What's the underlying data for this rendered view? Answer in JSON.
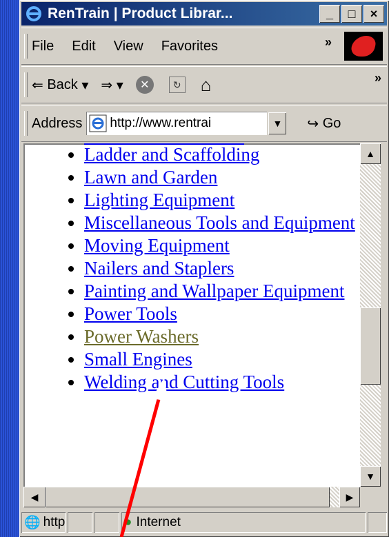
{
  "window": {
    "title": "RenTrain | Product Librar..."
  },
  "title_controls": [
    "_",
    "□",
    "×"
  ],
  "menu": {
    "items": [
      "File",
      "Edit",
      "View",
      "Favorites"
    ],
    "overflow": "»"
  },
  "navbar": {
    "back_label": "Back",
    "back_arrow": "⇐",
    "forward_arrow": "⇒",
    "overflow": "»"
  },
  "address": {
    "label": "Address",
    "value": "http://www.rentrai",
    "go_label": "Go"
  },
  "list": {
    "items": [
      {
        "label": "Ladder and Scaffolding",
        "visited": false
      },
      {
        "label": "Lawn and Garden",
        "visited": false
      },
      {
        "label": "Lighting Equipment",
        "visited": false
      },
      {
        "label": "Miscellaneous Tools and Equipment",
        "visited": false
      },
      {
        "label": "Moving Equipment",
        "visited": false
      },
      {
        "label": "Nailers and Staplers",
        "visited": false
      },
      {
        "label": "Painting and Wallpaper Equipment",
        "visited": false
      },
      {
        "label": "Power Tools",
        "visited": false
      },
      {
        "label": "Power Washers",
        "visited": true
      },
      {
        "label": "Small Engines",
        "visited": false
      },
      {
        "label": "Welding and Cutting Tools",
        "visited": false
      }
    ]
  },
  "status": {
    "url_text": "http",
    "zone": "Internet"
  },
  "colors": {
    "link": "#0000ee",
    "visited": "#6b6b2b",
    "annotation_arrow": "#ff0000"
  }
}
